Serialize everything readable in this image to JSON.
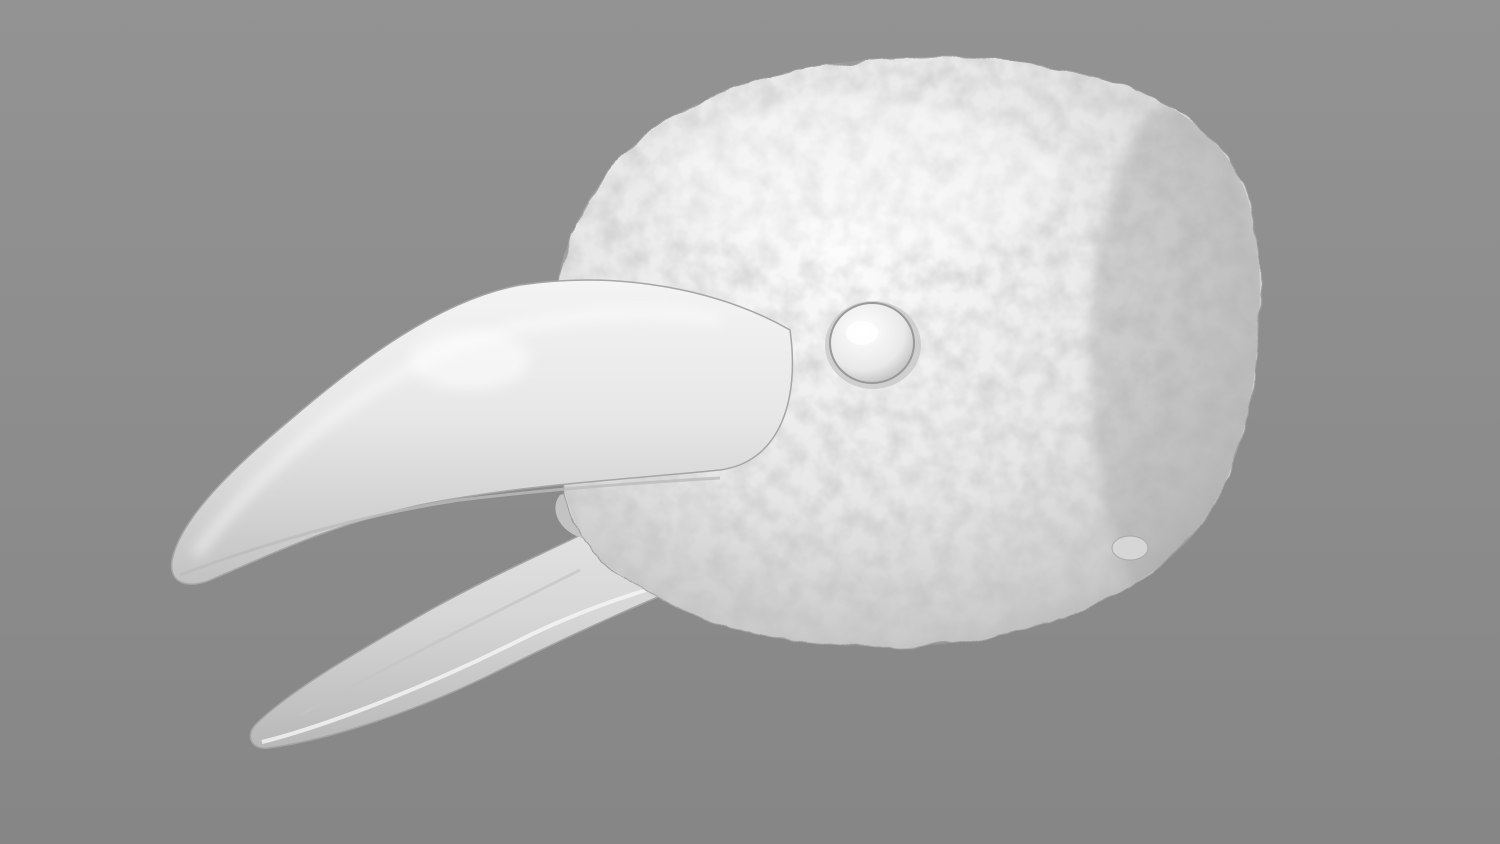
{
  "scene": {
    "subject": "crow-head",
    "render_style": "untextured-clay",
    "colors": {
      "background": "#8f8f8f",
      "model_base": "#e2e2e2",
      "model_highlight": "#fbfbfb",
      "model_shadow": "#a9a9a9",
      "mouth_interior": "#cfcfcf"
    }
  }
}
